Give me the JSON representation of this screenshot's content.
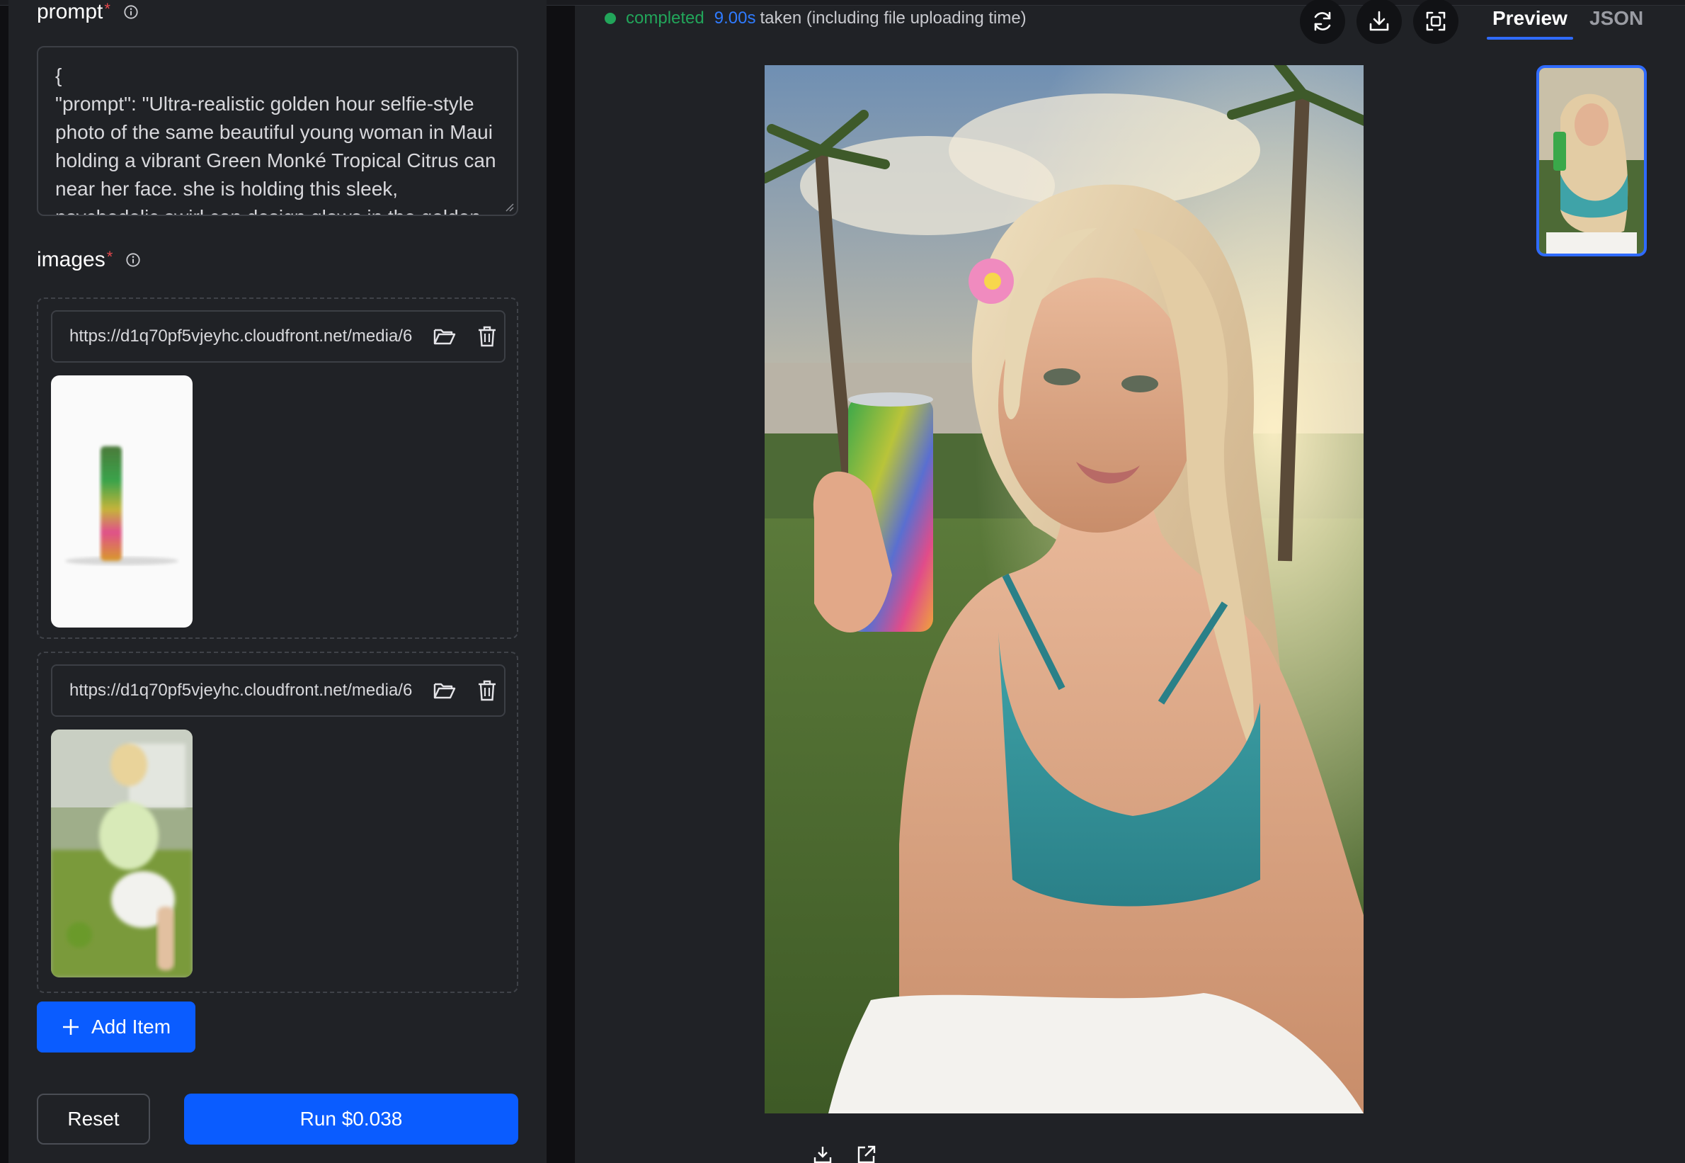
{
  "input_form": {
    "prompt_label": "prompt",
    "required_marker": "*",
    "prompt_value": "{\n\"prompt\": \"Ultra-realistic golden hour selfie-style photo of the same beautiful young woman in Maui holding a vibrant Green Monké Tropical Citrus can near her face. she is holding this sleek, psychedelic swirl can design glows in the golden",
    "images_label": "images",
    "image_items": [
      {
        "url": "https://d1q70pf5vjeyhc.cloudfront.net/media/6"
      },
      {
        "url": "https://d1q70pf5vjeyhc.cloudfront.net/media/6"
      }
    ],
    "add_item_label": "Add Item",
    "reset_label": "Reset",
    "run_label": "Run $0.038"
  },
  "output": {
    "status": "completed",
    "time": "9.00s",
    "time_note": "taken (including file uploading time)",
    "tabs": [
      "Preview",
      "JSON"
    ],
    "active_tab": "Preview"
  },
  "colors": {
    "accent": "#0a5cff",
    "success": "#22a55a",
    "panel": "#202226",
    "required": "#e5484d"
  },
  "icons": [
    "info-icon",
    "folder-open-icon",
    "trash-icon",
    "plus-icon",
    "refresh-icon",
    "download-icon",
    "fullscreen-icon",
    "open-external-icon"
  ]
}
